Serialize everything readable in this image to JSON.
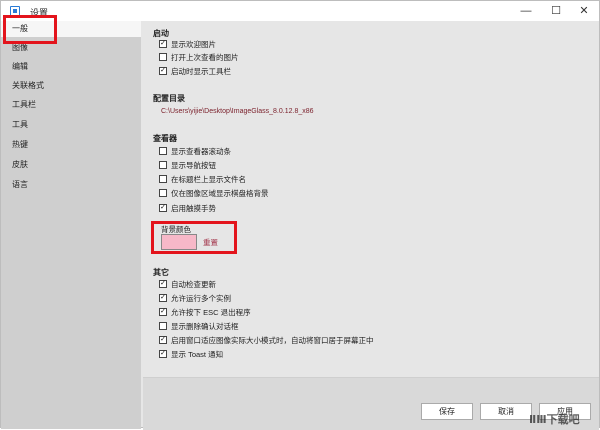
{
  "window": {
    "title": "设置"
  },
  "sidebar": {
    "items": [
      {
        "label": "一般"
      },
      {
        "label": "图像"
      },
      {
        "label": "编辑"
      },
      {
        "label": "关联格式"
      },
      {
        "label": "工具栏"
      },
      {
        "label": "工具"
      },
      {
        "label": "热键"
      },
      {
        "label": "皮肤"
      },
      {
        "label": "语言"
      }
    ]
  },
  "startup": {
    "title": "启动",
    "options": [
      {
        "label": "显示欢迎图片",
        "checked": true
      },
      {
        "label": "打开上次查看的图片",
        "checked": false
      },
      {
        "label": "启动时显示工具栏",
        "checked": true
      }
    ]
  },
  "config": {
    "title": "配置目录",
    "path": "C:\\Users\\yijie\\Desktop\\ImageGlass_8.0.12.8_x86"
  },
  "viewer": {
    "title": "查看器",
    "options": [
      {
        "label": "显示查看器滚动条",
        "checked": false
      },
      {
        "label": "显示导航按钮",
        "checked": false
      },
      {
        "label": "在标题栏上显示文件名",
        "checked": false
      },
      {
        "label": "仅在图像区域显示棋盘格背景",
        "checked": false
      },
      {
        "label": "启用触摸手势",
        "checked": true
      }
    ],
    "bg_color_label": "背景颜色",
    "bg_color": "#f7b8c8",
    "reset_label": "重置"
  },
  "other": {
    "title": "其它",
    "options": [
      {
        "label": "自动检查更新",
        "checked": true
      },
      {
        "label": "允许运行多个实例",
        "checked": true
      },
      {
        "label": "允许按下 ESC 退出程序",
        "checked": true
      },
      {
        "label": "显示删除确认对话框",
        "checked": false
      },
      {
        "label": "启用窗口适应图像实际大小模式时，自动将窗口居于屏幕正中",
        "checked": true
      },
      {
        "label": "显示 Toast 通知",
        "checked": true
      }
    ]
  },
  "buttons": {
    "save": "保存",
    "cancel": "取消",
    "apply": "应用"
  },
  "watermark": "ⅡⅢ下载吧",
  "colors": {
    "highlight": "#e3141c",
    "sidebar_bg": "#cfcfcf",
    "content_bg": "#e6e6e6"
  }
}
